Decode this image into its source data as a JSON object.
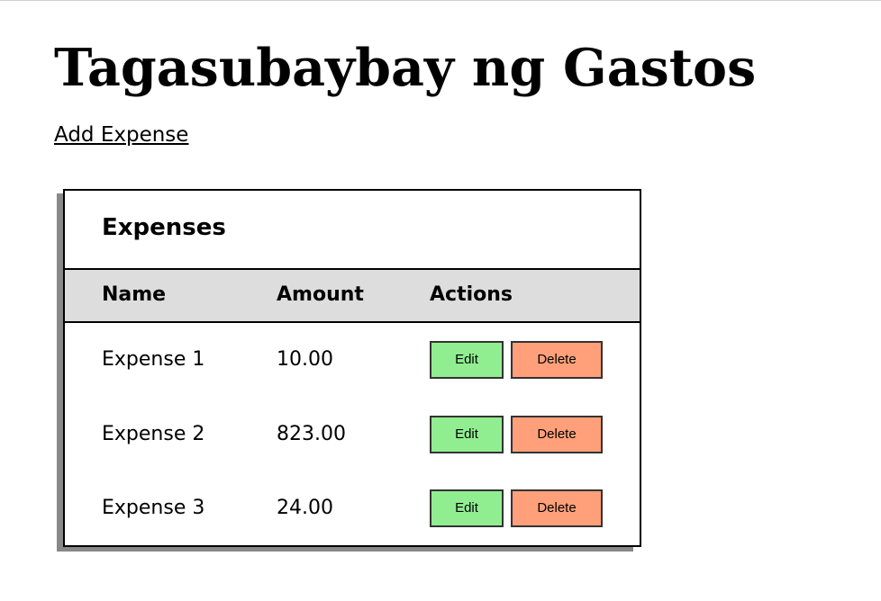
{
  "page": {
    "title": "Tagasubaybay ng Gastos",
    "add_link": "Add Expense"
  },
  "card": {
    "title": "Expenses",
    "columns": {
      "name": "Name",
      "amount": "Amount",
      "actions": "Actions"
    },
    "rows": [
      {
        "name": "Expense 1",
        "amount": "10.00",
        "edit": "Edit",
        "delete": "Delete"
      },
      {
        "name": "Expense 2",
        "amount": "823.00",
        "edit": "Edit",
        "delete": "Delete"
      },
      {
        "name": "Expense 3",
        "amount": "24.00",
        "edit": "Edit",
        "delete": "Delete"
      }
    ]
  },
  "colors": {
    "edit_button": "#90ee90",
    "delete_button": "#ffa07a",
    "header_background": "#dddddd",
    "shadow": "#888888"
  }
}
